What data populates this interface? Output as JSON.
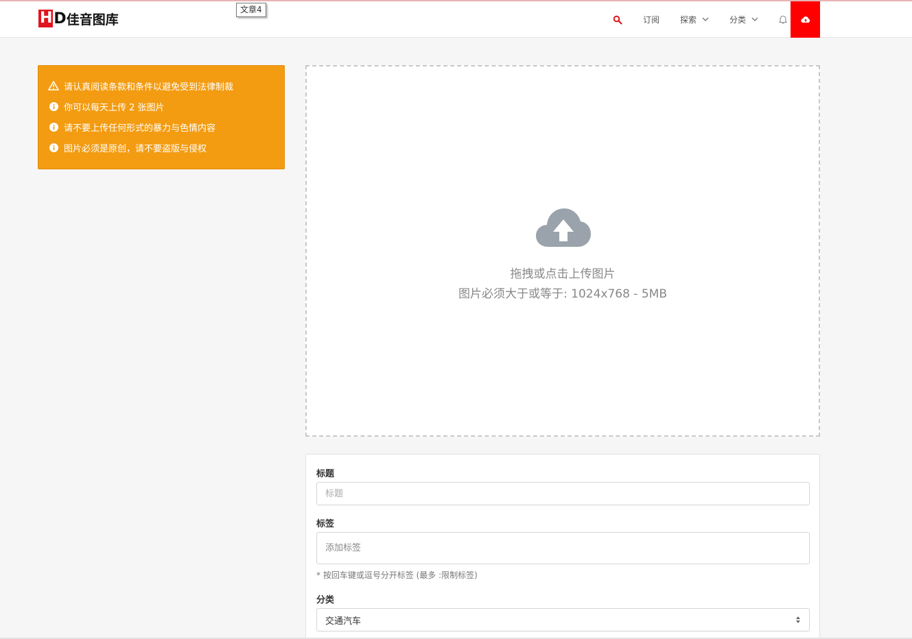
{
  "brand": {
    "logo_h": "H",
    "logo_d": "D",
    "logo_text": "佳音图库",
    "accent": "#e0161e"
  },
  "tooltip": {
    "text": "文章4"
  },
  "nav": {
    "search_icon": "search-icon",
    "subscribe": "订阅",
    "explore": "探索",
    "categories": "分类",
    "bell_icon": "bell-icon",
    "upload_icon": "cloud-upload-icon",
    "upload_color": "#ff0000"
  },
  "alert": {
    "color": "#f39c12",
    "items": [
      {
        "icon": "warning-icon",
        "text": "请认真阅读条款和条件以避免受到法律制裁"
      },
      {
        "icon": "info-icon",
        "text": "你可以每天上传 2 张图片"
      },
      {
        "icon": "info-icon",
        "text": "请不要上传任何形式的暴力与色情内容"
      },
      {
        "icon": "info-icon",
        "text": "图片必须是原创，请不要盗版与侵权"
      }
    ]
  },
  "dropzone": {
    "icon": "cloud-upload-icon",
    "line1": "拖拽或点击上传图片",
    "line2": "图片必须大于或等于: 1024x768 - 5MB"
  },
  "form": {
    "title_label": "标题",
    "title_placeholder": "标题",
    "tags_label": "标签",
    "tags_placeholder": "添加标签",
    "tags_hint": "* 按回车键或逗号分开标签 (最多 :限制标签)",
    "category_label": "分类",
    "category_value": "交通汽车"
  }
}
